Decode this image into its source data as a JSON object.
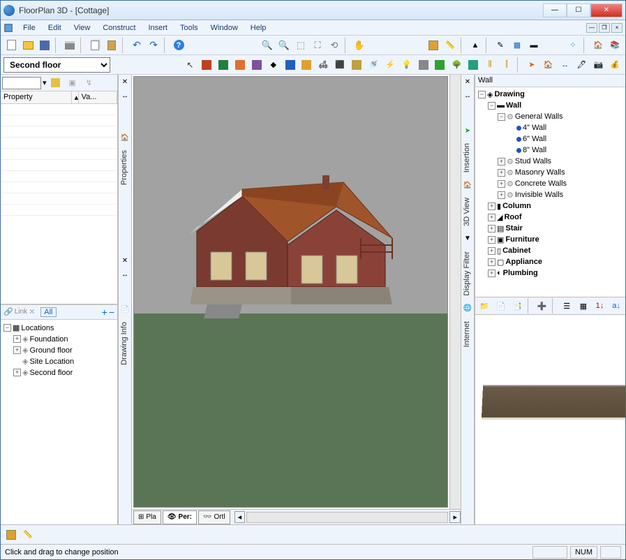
{
  "window": {
    "title": "FloorPlan 3D - [Cottage]"
  },
  "menu": {
    "file": "File",
    "edit": "Edit",
    "view": "View",
    "construct": "Construct",
    "insert": "Insert",
    "tools": "Tools",
    "window": "Window",
    "help": "Help"
  },
  "floor_selector": {
    "value": "Second floor"
  },
  "props": {
    "col_property": "Property",
    "col_value": "Va..."
  },
  "loc_toolbar": {
    "link": "Link",
    "all": "All"
  },
  "locations": {
    "root": "Locations",
    "items": [
      "Foundation",
      "Ground floor",
      "Site Location",
      "Second floor"
    ]
  },
  "vert_left": {
    "properties": "Properties",
    "drawing_info": "Drawing Info"
  },
  "vert_right": {
    "insertion": "Insertion",
    "view3d": "3D View",
    "display_filter": "Display Filter",
    "internet": "Internet"
  },
  "vp_tabs": {
    "plan": "Pla",
    "persp": "Per:",
    "ortho": "Ortl"
  },
  "right": {
    "header": "Wall",
    "tree": {
      "drawing": "Drawing",
      "wall": "Wall",
      "general": "General Walls",
      "w4": "4\" Wall",
      "w6": "6\" Wall",
      "w8": "8\" Wall",
      "stud": "Stud Walls",
      "masonry": "Masonry Walls",
      "concrete": "Concrete Walls",
      "invisible": "Invisible Walls",
      "column": "Column",
      "roof": "Roof",
      "stair": "Stair",
      "furniture": "Furniture",
      "cabinet": "Cabinet",
      "appliance": "Appliance",
      "plumbing": "Plumbing"
    }
  },
  "status": {
    "hint": "Click and drag to change position",
    "num": "NUM"
  }
}
